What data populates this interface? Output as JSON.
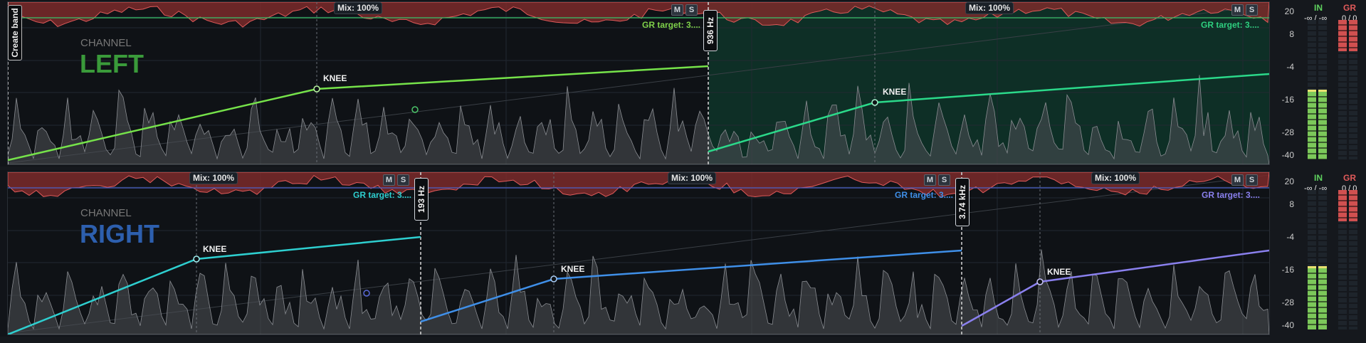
{
  "create_band_label": "Create band",
  "channel_caption": "CHANNEL",
  "knee_label": "KNEE",
  "scale_ticks": [
    "20",
    "8",
    "-4",
    "-16",
    "-28",
    "-40"
  ],
  "meters": {
    "in_label": "IN",
    "gr_label": "GR",
    "in_value": "-∞ / -∞",
    "gr_value": "0 / 0"
  },
  "mute_label": "M",
  "solo_label": "S",
  "left": {
    "name": "LEFT",
    "color": "#3a9a3a",
    "mix": [
      "Mix: 100%",
      "Mix: 100%"
    ],
    "gr_target": [
      "GR target: 3....",
      "GR target: 3...."
    ],
    "freqs": [
      "936 Hz"
    ],
    "band_colors": [
      "#76e34a",
      "#2bd98a"
    ]
  },
  "right": {
    "name": "RIGHT",
    "color": "#2d5fae",
    "mix": [
      "Mix: 100%",
      "Mix: 100%",
      "Mix: 100%"
    ],
    "gr_target": [
      "GR target: 3....",
      "GR target: 3....",
      "GR target: 3...."
    ],
    "freqs": [
      "193 Hz",
      "3.74 kHz"
    ],
    "band_colors": [
      "#2ecfd0",
      "#3f8fe8",
      "#8a80ee"
    ]
  }
}
